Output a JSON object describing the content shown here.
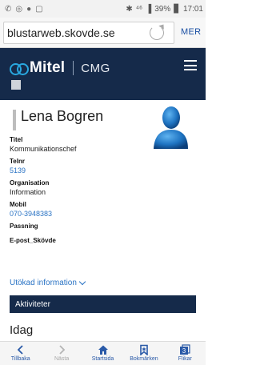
{
  "status_bar": {
    "signal_label": "⁴⁶",
    "battery": "39%",
    "time": "17:01"
  },
  "browser": {
    "url": "blustarweb.skovde.se",
    "more_label": "MER"
  },
  "header": {
    "logo": "Mitel",
    "subtitle": "CMG"
  },
  "profile": {
    "name": "Lena Bogren",
    "fields": [
      {
        "label": "Titel",
        "value": "Kommunikationschef",
        "link": false
      },
      {
        "label": "Telnr",
        "value": "5139",
        "link": true
      },
      {
        "label": "Organisation",
        "value": "Information",
        "link": false
      },
      {
        "label": "Mobil",
        "value": "070-3948383",
        "link": true
      },
      {
        "label": "Passning",
        "value": "",
        "link": false
      },
      {
        "label": "E-post_Skövde",
        "value": "",
        "link": false
      }
    ],
    "more_info": "Utökad information",
    "activities_title": "Aktiviteter",
    "today_label": "Idag"
  },
  "bottom_nav": {
    "back": "Tillbaka",
    "forward": "Nästa",
    "home": "Startsida",
    "bookmarks": "Bokmärken",
    "tabs": "Flikar",
    "tab_count": "3"
  },
  "colors": {
    "header_bg": "#152a4a",
    "link": "#2a73c4",
    "logo_accent": "#29a8e0"
  }
}
